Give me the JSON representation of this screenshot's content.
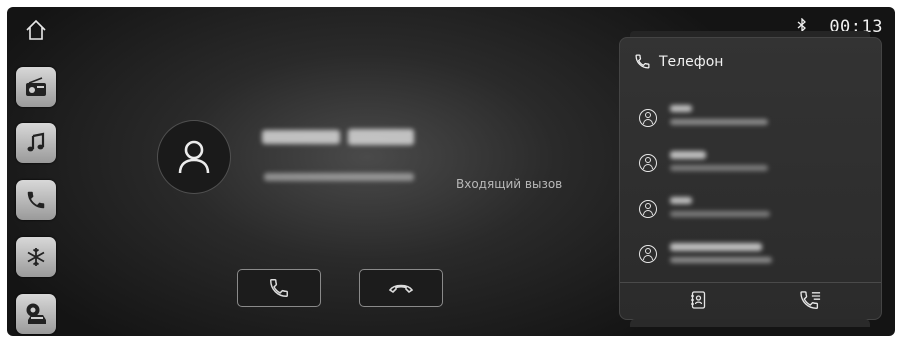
{
  "status": {
    "time": "00:13",
    "bluetooth_icon": "bluetooth-icon"
  },
  "sidebar": {
    "items": [
      {
        "name": "radio",
        "icon": "radio-icon"
      },
      {
        "name": "music",
        "icon": "music-note-icon"
      },
      {
        "name": "phone",
        "icon": "phone-icon"
      },
      {
        "name": "climate",
        "icon": "snowflake-icon"
      },
      {
        "name": "vehicle-settings",
        "icon": "car-gear-icon"
      }
    ]
  },
  "call": {
    "status_text": "Входящий вызов",
    "accept_icon": "phone-icon",
    "decline_icon": "hang-up-icon"
  },
  "phone_panel": {
    "title": "Телефон",
    "contacts": [
      {
        "number_text": ""
      },
      {
        "number_text": "17779997218"
      },
      {
        "number_text": "13422403607"
      },
      {
        "number_text": ""
      }
    ],
    "bottom_buttons": [
      {
        "icon": "contacts-book-icon"
      },
      {
        "icon": "call-log-icon"
      }
    ]
  }
}
